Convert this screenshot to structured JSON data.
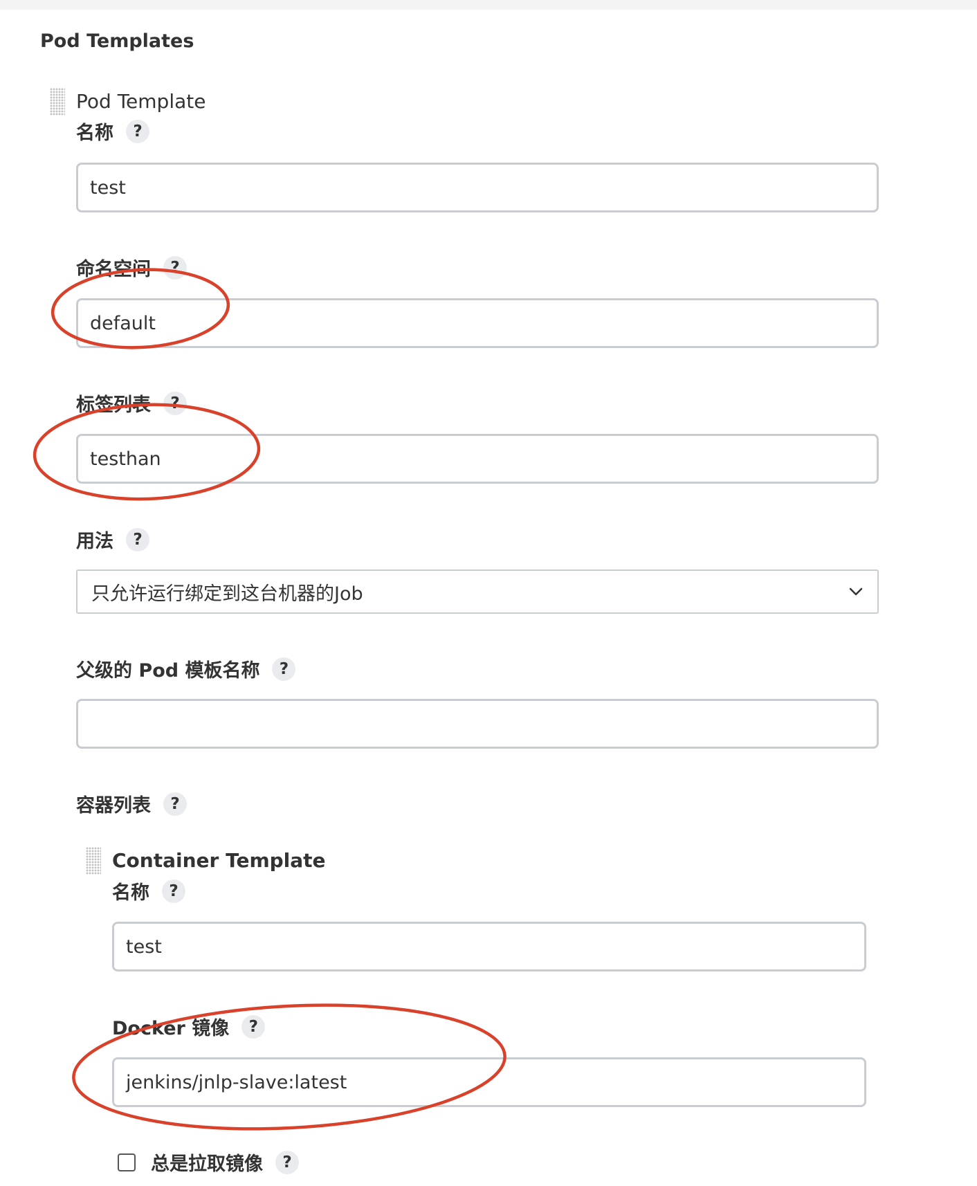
{
  "section_title": "Pod Templates",
  "pod_template": {
    "heading": "Pod Template",
    "name": {
      "label": "名称",
      "value": "test"
    },
    "namespace": {
      "label": "命名空间",
      "value": "default"
    },
    "labels": {
      "label": "标签列表",
      "value": "testhan"
    },
    "usage": {
      "label": "用法",
      "selected": "只允许运行绑定到这台机器的Job"
    },
    "parent_template": {
      "label": "父级的 Pod 模板名称",
      "value": ""
    },
    "containers": {
      "label": "容器列表"
    }
  },
  "container_template": {
    "heading": "Container Template",
    "name": {
      "label": "名称",
      "value": "test"
    },
    "docker_image": {
      "label": "Docker 镜像",
      "value": "jenkins/jnlp-slave:latest"
    },
    "always_pull": {
      "label": "总是拉取镜像",
      "checked": false
    }
  },
  "help_symbol": "?",
  "colors": {
    "annotation_red": "#d9412b",
    "field_border": "#c9ccd1",
    "help_bg": "#e9ebee"
  }
}
